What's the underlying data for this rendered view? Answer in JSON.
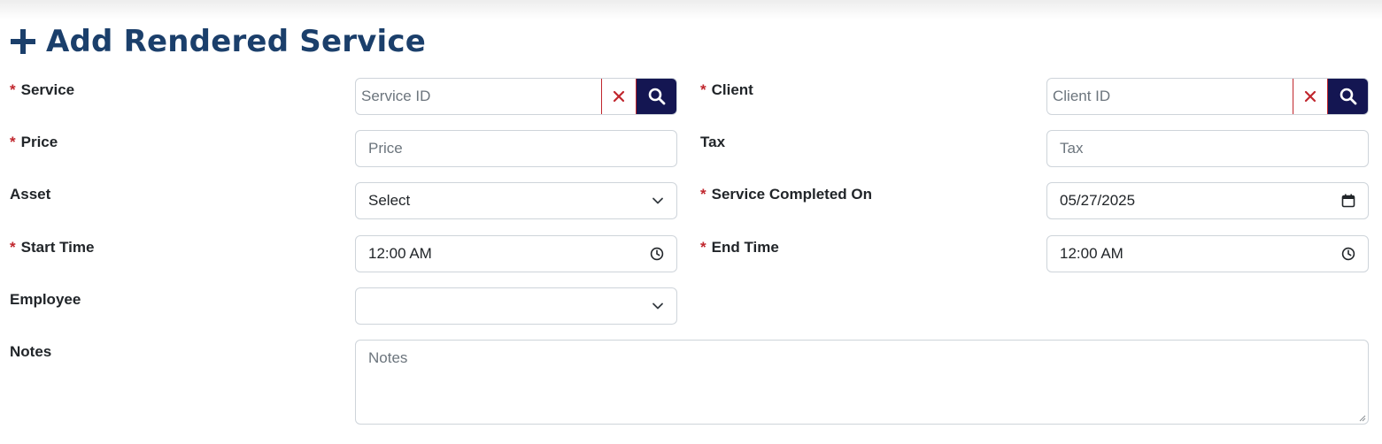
{
  "page": {
    "title": "Add Rendered Service"
  },
  "form": {
    "service": {
      "label": "Service",
      "placeholder": "Service ID",
      "value": ""
    },
    "client": {
      "label": "Client",
      "placeholder": "Client ID",
      "value": ""
    },
    "price": {
      "label": "Price",
      "placeholder": "Price",
      "value": ""
    },
    "tax": {
      "label": "Tax",
      "placeholder": "Tax",
      "value": ""
    },
    "asset": {
      "label": "Asset",
      "selected": "Select"
    },
    "completed_on": {
      "label": "Service Completed On",
      "value": "05/27/2025"
    },
    "start_time": {
      "label": "Start Time",
      "value": "12:00 AM"
    },
    "end_time": {
      "label": "End Time",
      "value": "12:00 AM"
    },
    "employee": {
      "label": "Employee",
      "selected": ""
    },
    "notes": {
      "label": "Notes",
      "placeholder": "Notes",
      "value": ""
    },
    "required_marker": "*"
  },
  "icons": {
    "add": "plus-icon",
    "clear": "close-icon",
    "search": "search-icon",
    "dropdown": "chevron-down-icon",
    "calendar": "calendar-icon",
    "clock": "clock-icon"
  },
  "colors": {
    "title": "#1b3f6b",
    "required": "#c0262d",
    "search_button": "#141652",
    "clear_button": "#c0262d"
  }
}
